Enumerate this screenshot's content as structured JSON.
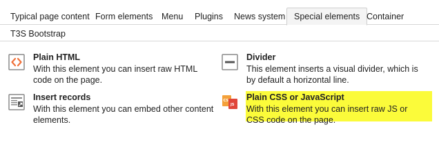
{
  "tabs": [
    {
      "label": "Typical page content",
      "active": false
    },
    {
      "label": "Form elements",
      "active": false
    },
    {
      "label": "Menu",
      "active": false
    },
    {
      "label": "Plugins",
      "active": false
    },
    {
      "label": "News system",
      "active": false
    },
    {
      "label": "Special elements",
      "active": true
    },
    {
      "label": "Container",
      "active": false
    },
    {
      "label": "T3S Bootstrap",
      "active": false
    }
  ],
  "items": [
    {
      "title": "Plain HTML",
      "description": "With this element you can insert raw HTML code on the page.",
      "icon": "html-code-icon"
    },
    {
      "title": "Divider",
      "description": "This element inserts a visual divider, which is by default a horizontal line.",
      "icon": "divider-icon"
    },
    {
      "title": "Insert records",
      "description": "With this element you can embed other content elements.",
      "icon": "insert-records-icon"
    },
    {
      "title": "Plain CSS or JavaScript",
      "description": "With this element you can insert raw JS or CSS code on the page.",
      "icon": "css-js-icon",
      "highlighted": true
    }
  ],
  "colors": {
    "highlight": "#ffff3d",
    "html_icon": "#f0713a",
    "css_badge": "#f4a13a",
    "js_badge": "#e0463a"
  }
}
